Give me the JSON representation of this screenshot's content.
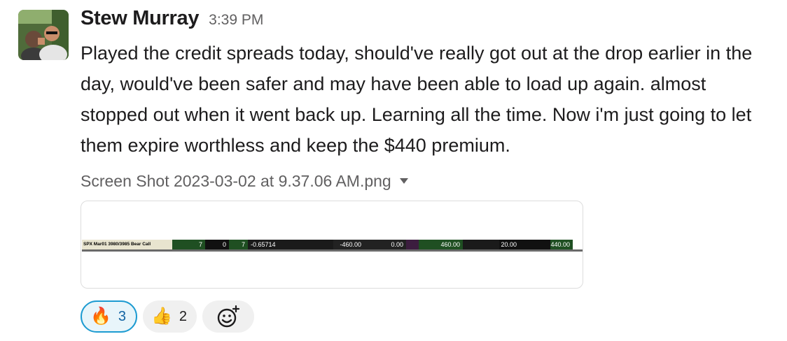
{
  "message": {
    "author": "Stew Murray",
    "timestamp": "3:39 PM",
    "text": "Played the credit spreads today, should've really got out at the drop earlier in the day, would've been safer and may have been able to load up again. almost stopped out when it went back up.  Learning all the time.  Now i'm just going to let them expire worthless and keep the $440 premium.",
    "avatar_icon": "user-photo-avatar"
  },
  "attachment": {
    "file_name": "Screen Shot 2023-03-02 at 9.37.06 AM.png",
    "menu_icon": "caret-down-icon",
    "row": {
      "name": "SPX Mar01 3980/3985 Bear Call",
      "qty": "7",
      "zero": "0",
      "seven": "7",
      "delta": "-0.65714",
      "neg": "-460.00",
      "zero2": "0.00",
      "pos": "460.00",
      "twenty": "20.00",
      "premium": "440.00"
    }
  },
  "reactions": [
    {
      "emoji": "🔥",
      "count": "3",
      "active": true
    },
    {
      "emoji": "👍",
      "count": "2",
      "active": false
    }
  ],
  "add_reaction_icon": "add-reaction-icon",
  "colors": {
    "active_reaction_border": "#1d9bd1",
    "active_reaction_bg": "#e8f5fa",
    "reaction_bg": "#f0f0f0",
    "muted_text": "#616061"
  }
}
